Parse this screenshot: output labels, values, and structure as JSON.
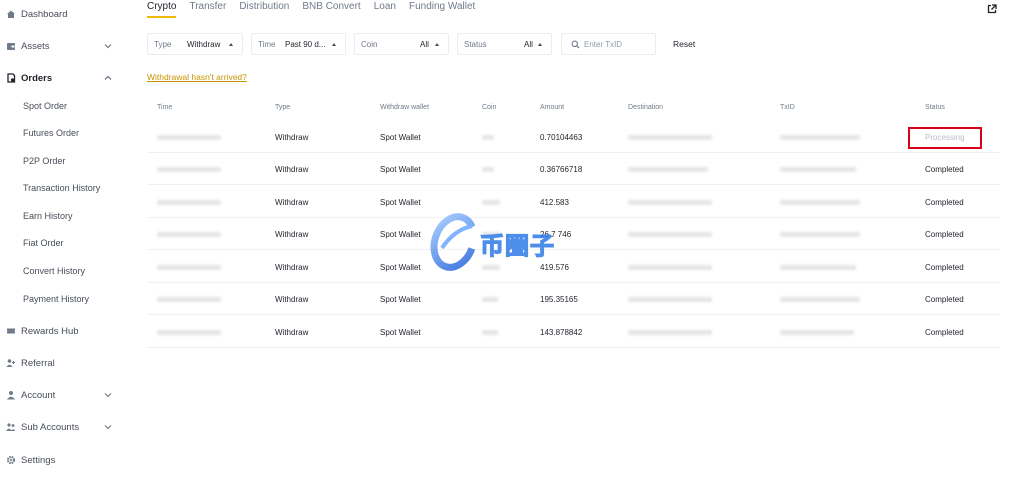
{
  "sidebar": {
    "dashboard": "Dashboard",
    "assets": "Assets",
    "orders": "Orders",
    "orders_sub": [
      "Spot Order",
      "Futures Order",
      "P2P Order",
      "Transaction History",
      "Earn History",
      "Fiat Order",
      "Convert History",
      "Payment History"
    ],
    "rewards": "Rewards Hub",
    "referral": "Referral",
    "account": "Account",
    "sub_accounts": "Sub Accounts",
    "settings": "Settings"
  },
  "tabs": [
    "Crypto",
    "Transfer",
    "Distribution",
    "BNB Convert",
    "Loan",
    "Funding Wallet"
  ],
  "filters": {
    "type_label": "Type",
    "type_value": "Withdraw",
    "time_label": "Time",
    "time_value": "Past 90 d...",
    "coin_label": "Coin",
    "coin_value": "All",
    "status_label": "Status",
    "status_value": "All",
    "search_placeholder": "Enter TxID",
    "reset": "Reset"
  },
  "notice": "Withdrawal hasn't arrived?",
  "table": {
    "headers": [
      "Time",
      "Type",
      "Withdraw wallet",
      "Coin",
      "Amount",
      "Destination",
      "TxID",
      "Status"
    ],
    "rows": [
      {
        "type": "Withdraw",
        "wallet": "Spot Wallet",
        "amount": "0.70104463",
        "status": "Processing"
      },
      {
        "type": "Withdraw",
        "wallet": "Spot Wallet",
        "amount": "0.36766718",
        "status": "Completed"
      },
      {
        "type": "Withdraw",
        "wallet": "Spot Wallet",
        "amount": "412.583",
        "status": "Completed"
      },
      {
        "type": "Withdraw",
        "wallet": "Spot Wallet",
        "amount": "26.7 746",
        "status": "Completed"
      },
      {
        "type": "Withdraw",
        "wallet": "Spot Wallet",
        "amount": "419.576",
        "status": "Completed"
      },
      {
        "type": "Withdraw",
        "wallet": "Spot Wallet",
        "amount": "195.35165",
        "status": "Completed"
      },
      {
        "type": "Withdraw",
        "wallet": "Spot Wallet",
        "amount": "143.878842",
        "status": "Completed"
      }
    ]
  },
  "watermark": "币圈子",
  "colors": {
    "accent": "#f0b90b",
    "link": "#c99400",
    "highlight": "#d9001b",
    "muted": "#707a8a"
  }
}
